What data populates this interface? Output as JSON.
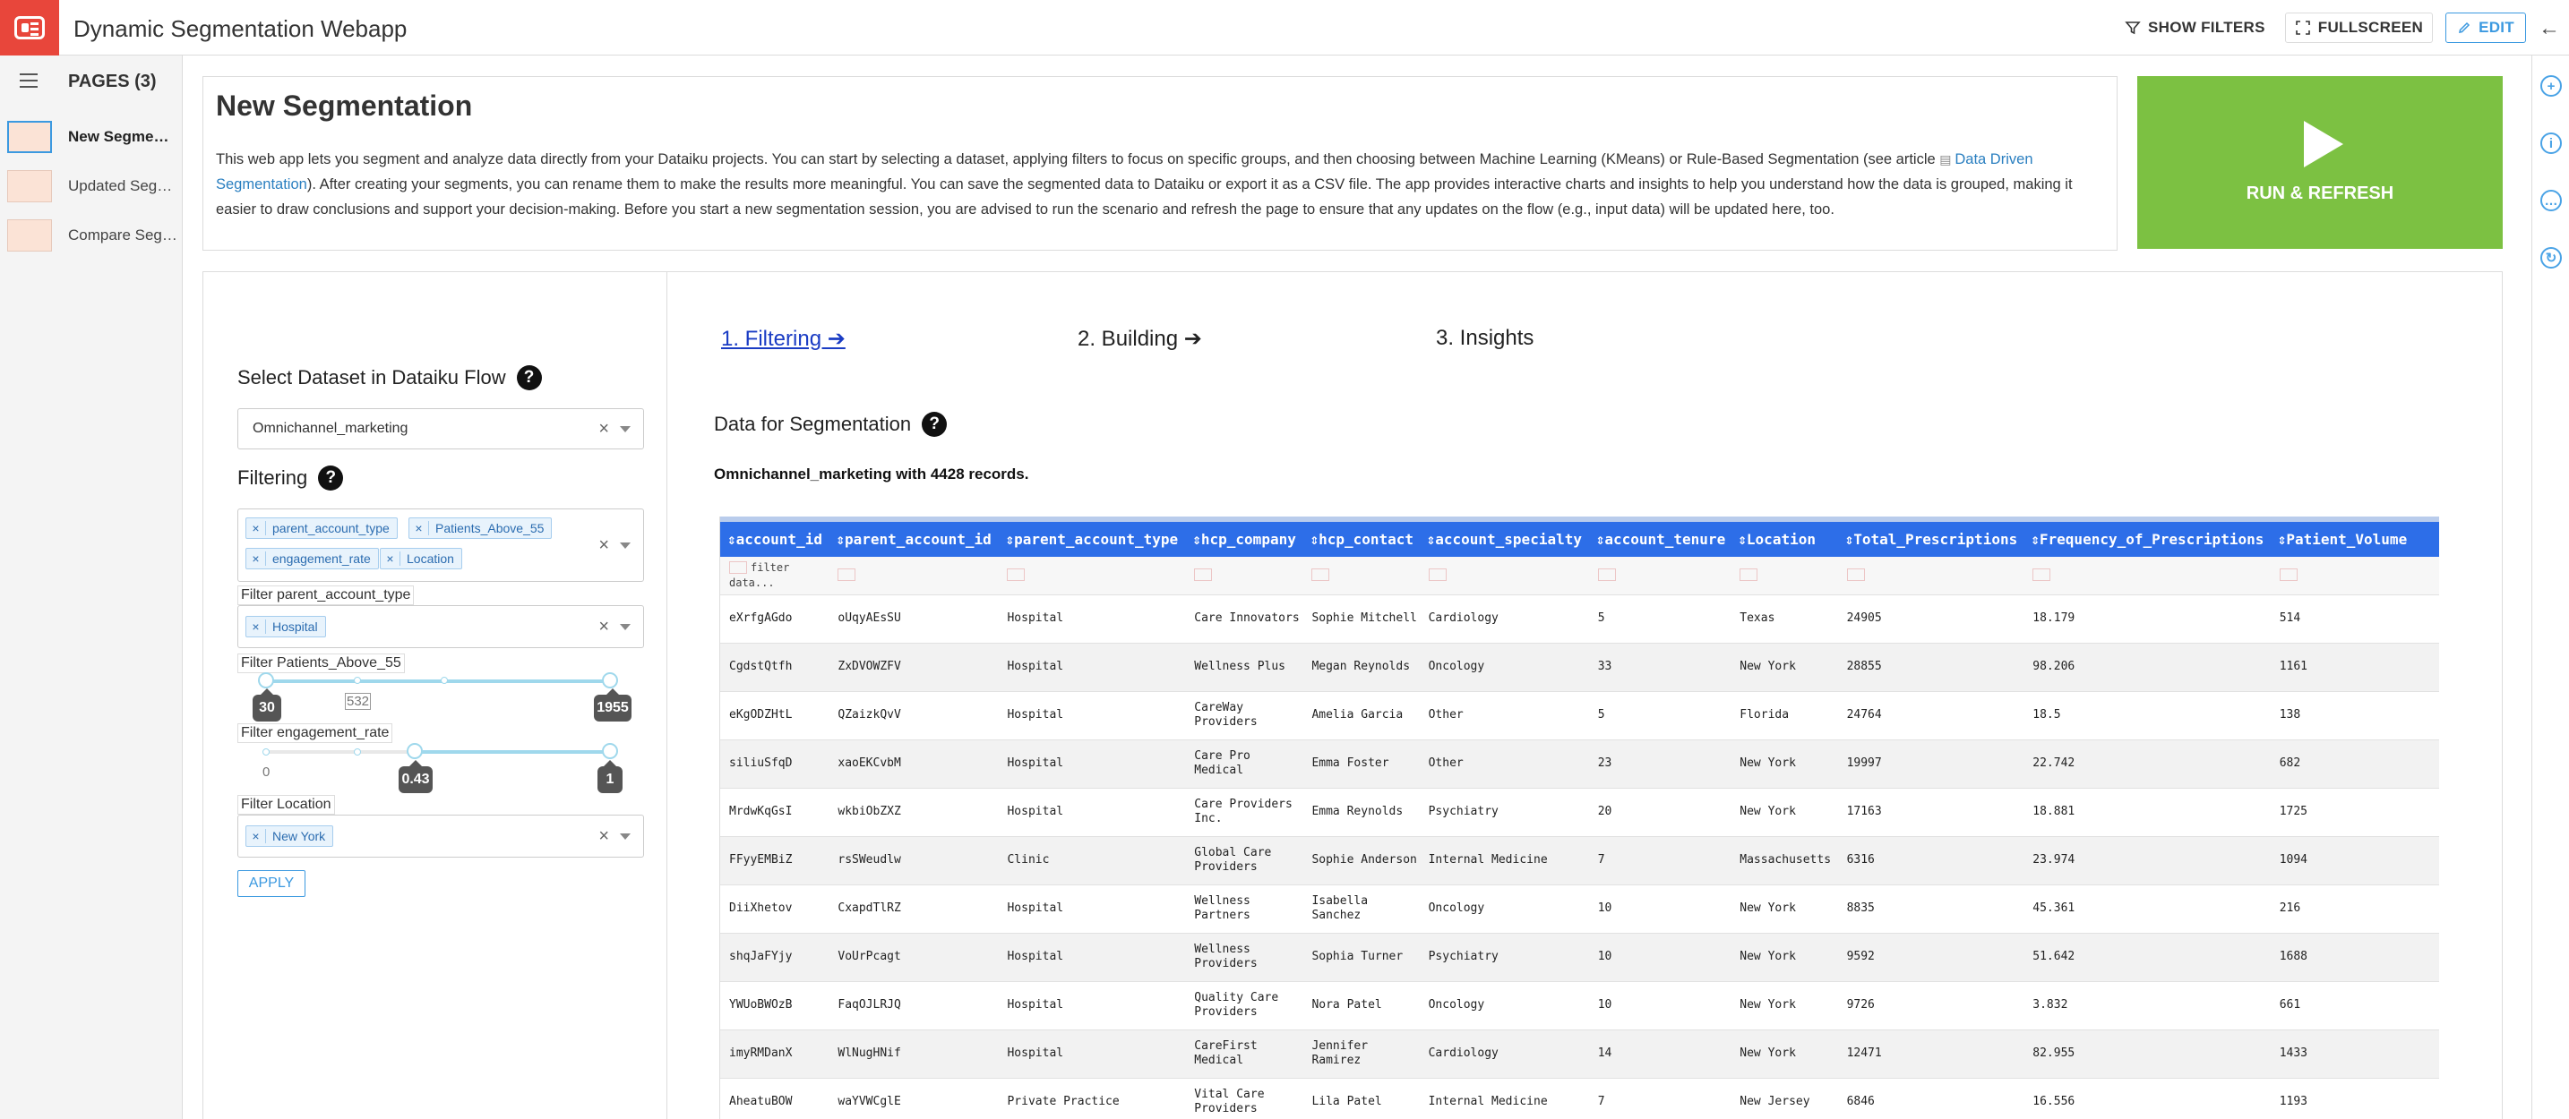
{
  "app": {
    "title": "Dynamic Segmentation Webapp"
  },
  "topbar": {
    "show_filters": "SHOW FILTERS",
    "fullscreen": "FULLSCREEN",
    "edit": "EDIT"
  },
  "sidebar": {
    "pages_title": "PAGES (3)",
    "pages": [
      {
        "label": "New Segmentation"
      },
      {
        "label": "Updated Segmentation"
      },
      {
        "label": "Compare Segmentations"
      }
    ]
  },
  "header": {
    "title": "New Segmentation",
    "desc_part1": "This web app lets you segment and analyze data directly from your Dataiku projects. You can start by selecting a dataset, applying filters to focus on specific groups, and then choosing between Machine Learning (KMeans) or Rule-Based Segmentation (see article ",
    "desc_link": "Data Driven Segmentation",
    "desc_part2": "). After creating your segments, you can rename them to make the results more meaningful. You can save the segmented data to Dataiku or export it as a CSV file. The app provides interactive charts and insights to help you understand how the data is grouped, making it easier to draw conclusions and support your decision-making. Before you start a new segmentation session, you are advised to run the scenario and refresh the page to ensure that any updates on the flow (e.g., input data) will be updated here, too.",
    "run_label": "RUN & REFRESH"
  },
  "left_panel": {
    "dataset_label": "Select Dataset in Dataiku Flow",
    "dataset_value": "Omnichannel_marketing",
    "filtering_label": "Filtering",
    "filter_chips": [
      "parent_account_type",
      "Patients_Above_55",
      "engagement_rate",
      "Location"
    ],
    "filter_parent_label": "Filter parent_account_type",
    "filter_parent_value": "Hospital",
    "filter_patients_label": "Filter Patients_Above_55",
    "patients_min": "30",
    "patients_mid": "532",
    "patients_max": "1955",
    "filter_engagement_label": "Filter engagement_rate",
    "engagement_min_mark": "0",
    "engagement_low": "0.43",
    "engagement_high": "1",
    "filter_location_label": "Filter Location",
    "filter_location_value": "New York",
    "apply_label": "APPLY"
  },
  "steps": {
    "s1": "1. Filtering ➔",
    "s2": "2. Building ➔",
    "s3": "3. Insights"
  },
  "data_section": {
    "title": "Data for Segmentation",
    "records": "Omnichannel_marketing with 4428 records.",
    "filter_placeholder": "filter data..."
  },
  "table": {
    "columns": [
      "account_id",
      "parent_account_id",
      "parent_account_type",
      "hcp_company",
      "hcp_contact",
      "account_specialty",
      "account_tenure",
      "Location",
      "Total_Prescriptions",
      "Frequency_of_Prescriptions",
      "Patient_Volume"
    ],
    "rows": [
      [
        "eXrfgAGdo",
        "oUqyAEsSU",
        "Hospital",
        "Care Innovators",
        "Sophie Mitchell",
        "Cardiology",
        "5",
        "Texas",
        "24905",
        "18.179",
        "514"
      ],
      [
        "CgdstQtfh",
        "ZxDVOWZFV",
        "Hospital",
        "Wellness Plus",
        "Megan Reynolds",
        "Oncology",
        "33",
        "New York",
        "28855",
        "98.206",
        "1161"
      ],
      [
        "eKgODZHtL",
        "QZaizkQvV",
        "Hospital",
        "CareWay Providers",
        "Amelia Garcia",
        "Other",
        "5",
        "Florida",
        "24764",
        "18.5",
        "138"
      ],
      [
        "siliuSfqD",
        "xaoEKCvbM",
        "Hospital",
        "Care Pro Medical",
        "Emma Foster",
        "Other",
        "23",
        "New York",
        "19997",
        "22.742",
        "682"
      ],
      [
        "MrdwKqGsI",
        "wkbiObZXZ",
        "Hospital",
        "Care Providers Inc.",
        "Emma Reynolds",
        "Psychiatry",
        "20",
        "New York",
        "17163",
        "18.881",
        "1725"
      ],
      [
        "FFyyEMBiZ",
        "rsSWeudlw",
        "Clinic",
        "Global Care Providers",
        "Sophie Anderson",
        "Internal Medicine",
        "7",
        "Massachusetts",
        "6316",
        "23.974",
        "1094"
      ],
      [
        "DiiXhetov",
        "CxapdTlRZ",
        "Hospital",
        "Wellness Partners",
        "Isabella Sanchez",
        "Oncology",
        "10",
        "New York",
        "8835",
        "45.361",
        "216"
      ],
      [
        "shqJaFYjy",
        "VoUrPcagt",
        "Hospital",
        "Wellness Providers",
        "Sophia Turner",
        "Psychiatry",
        "10",
        "New York",
        "9592",
        "51.642",
        "1688"
      ],
      [
        "YWUoBWOzB",
        "FaqOJLRJQ",
        "Hospital",
        "Quality Care Providers",
        "Nora Patel",
        "Oncology",
        "10",
        "New York",
        "9726",
        "3.832",
        "661"
      ],
      [
        "imyRMDanX",
        "WlNugHNif",
        "Hospital",
        "CareFirst Medical",
        "Jennifer Ramirez",
        "Cardiology",
        "14",
        "New York",
        "12471",
        "82.955",
        "1433"
      ],
      [
        "AheatuBOW",
        "waYVWCglE",
        "Private Practice",
        "Vital Care Providers",
        "Lila Patel",
        "Internal Medicine",
        "7",
        "New Jersey",
        "6846",
        "16.556",
        "1193"
      ]
    ]
  },
  "colors": {
    "brand": "#e8463b",
    "run_green": "#7cc142",
    "table_header": "#2d6ee8",
    "link": "#2a7fc0",
    "step_active": "#1a3cc4"
  },
  "icons": {
    "logo": "dashboard-icon",
    "filter": "funnel-icon",
    "fullscreen": "expand-icon",
    "edit": "pencil-icon"
  }
}
